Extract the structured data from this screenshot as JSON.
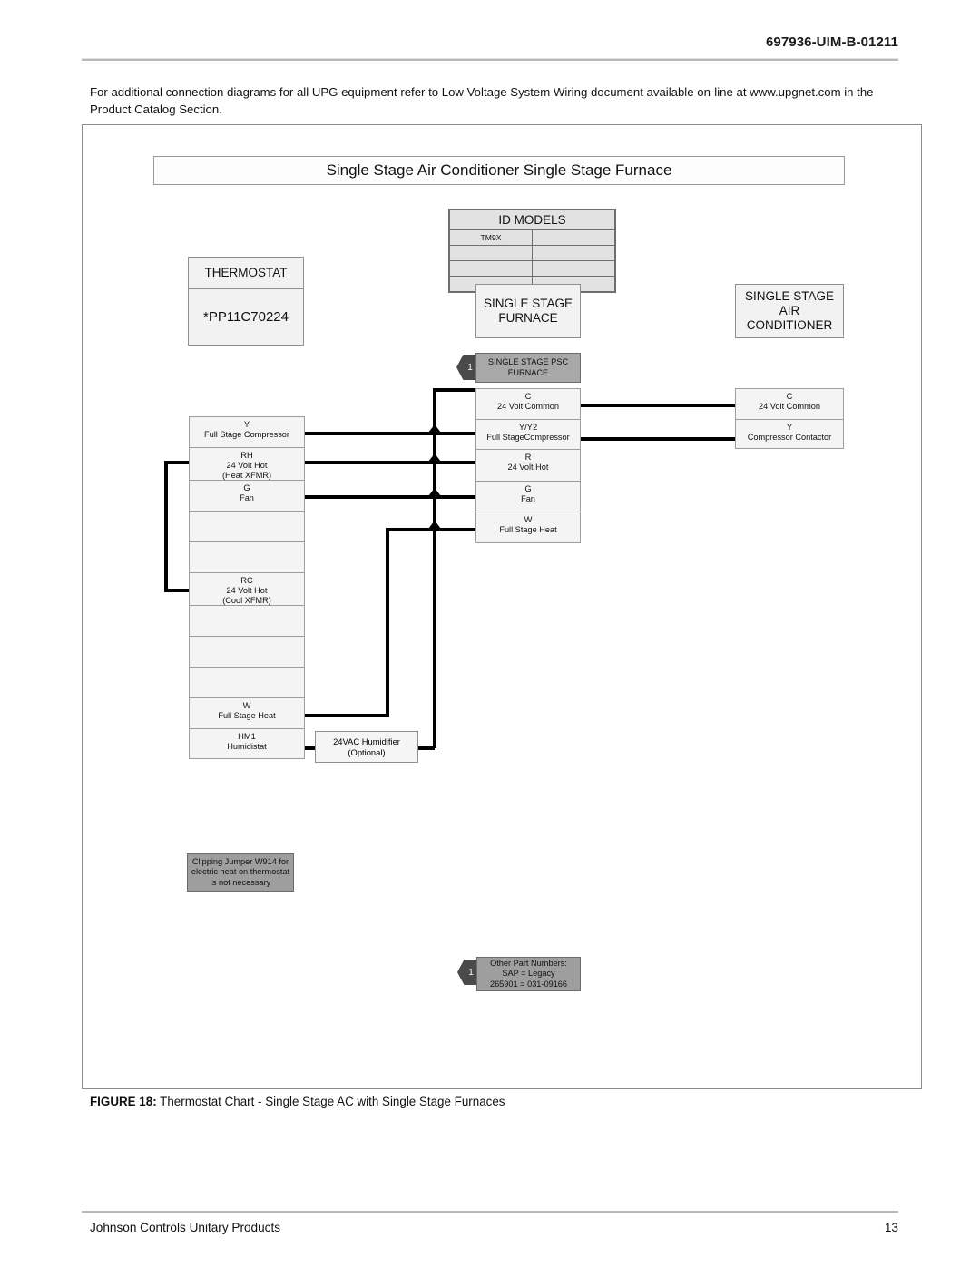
{
  "page": {
    "header_code": "697936-UIM-B-01211",
    "intro": "For additional connection diagrams for all UPG equipment refer to  Low Voltage System Wiring  document available on-line at www.upgnet.com in the Product Catalog Section.",
    "caption_label": "FIGURE 18:",
    "caption_text": "Thermostat Chart - Single Stage AC with Single Stage Furnaces",
    "footer_company": "Johnson Controls Unitary Products",
    "footer_page": "13"
  },
  "diagram": {
    "title": "Single Stage Air Conditioner  Single Stage Furnace",
    "id_models": {
      "header": "ID MODELS",
      "rows": [
        [
          "TM9X",
          ""
        ],
        [
          "",
          ""
        ],
        [
          "",
          ""
        ],
        [
          "",
          ""
        ]
      ]
    },
    "thermostat": {
      "header": "THERMOSTAT",
      "model": "*PP11C70224",
      "terminals": [
        {
          "term": "Y",
          "desc": "Full Stage Compressor"
        },
        {
          "term": "RH",
          "desc": "24    Volt Hot",
          "desc2": "(Heat XFMR)"
        },
        {
          "term": "G",
          "desc": "Fan"
        },
        {
          "term": "",
          "desc": ""
        },
        {
          "term": "",
          "desc": ""
        },
        {
          "term": "RC",
          "desc": "24    Volt Hot",
          "desc2": "(Cool XFMR)"
        },
        {
          "term": "",
          "desc": ""
        },
        {
          "term": "",
          "desc": ""
        },
        {
          "term": "",
          "desc": ""
        },
        {
          "term": "W",
          "desc": "Full Stage Heat"
        },
        {
          "term": "HM1",
          "desc": "Humidistat"
        }
      ]
    },
    "furnace": {
      "header": "SINGLE STAGE\nFURNACE",
      "psc_label": "SINGLE STAGE PSC\nFURNACE",
      "psc_marker": "1",
      "terminals": [
        {
          "term": "C",
          "desc": "24    Volt Common"
        },
        {
          "term": "Y/Y2",
          "desc": "Full StageCompressor"
        },
        {
          "term": "R",
          "desc": "24    Volt Hot"
        },
        {
          "term": "G",
          "desc": "Fan"
        },
        {
          "term": "W",
          "desc": "Full Stage Heat"
        }
      ]
    },
    "air_conditioner": {
      "header": "SINGLE STAGE\nAIR\nCONDITIONER",
      "terminals": [
        {
          "term": "C",
          "desc": "24    Volt Common"
        },
        {
          "term": "Y",
          "desc": "Compressor Contactor"
        }
      ]
    },
    "humidifier": {
      "line1": "24VAC Humidifier",
      "line2": "(Optional)"
    },
    "jumper_note": {
      "line1": "Clipping Jumper W914 for",
      "line2": "electric heat on thermostat",
      "line3": "is not necessary"
    },
    "part_numbers": {
      "marker": "1",
      "line1": "Other Part Numbers:",
      "line2": "SAP    =    Legacy",
      "line3": "265901  =  031-09166"
    }
  }
}
